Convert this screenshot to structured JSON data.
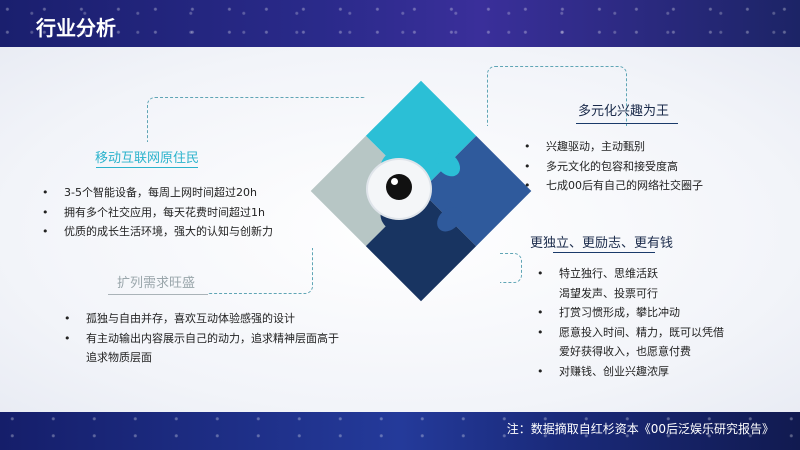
{
  "header": {
    "title": "行业分析"
  },
  "footer": {
    "note": "注：数据摘取自红杉资本《00后泛娱乐研究报告》"
  },
  "sections": {
    "mobile": {
      "title": "移动互联网原住民",
      "items": [
        "3-5个智能设备，每周上网时间超过20h",
        "拥有多个社交应用，每天花费时间超过1h",
        "优质的成长生活环境，强大的认知与创新力"
      ]
    },
    "social": {
      "title": "扩列需求旺盛",
      "items": [
        {
          "lines": [
            "孤独与自由并存，喜欢互动体验感强的设计"
          ]
        },
        {
          "lines": [
            "有主动输出内容展示自己的动力，追求精神层面高于",
            "追求物质层面"
          ]
        }
      ]
    },
    "interest": {
      "title": "多元化兴趣为王",
      "items": [
        "兴趣驱动，主动甄别",
        "多元文化的包容和接受度高",
        "七成00后有自己的网络社交圈子"
      ]
    },
    "independent": {
      "title": "更独立、更励志、更有钱",
      "items": [
        {
          "lines": [
            "特立独行、思维活跃",
            "渴望发声、投票可行"
          ]
        },
        {
          "lines": [
            "打赏习惯形成，攀比冲动"
          ]
        },
        {
          "lines": [
            "愿意投入时间、精力，既可以凭借",
            "爱好获得收入，也愿意付费"
          ]
        },
        {
          "lines": [
            "对赚钱、创业兴趣浓厚"
          ]
        }
      ]
    }
  },
  "colors": {
    "cyan": "#2bbfd6",
    "blue": "#2f5a9c",
    "navy": "#183461",
    "gray": "#b7c6c5"
  }
}
